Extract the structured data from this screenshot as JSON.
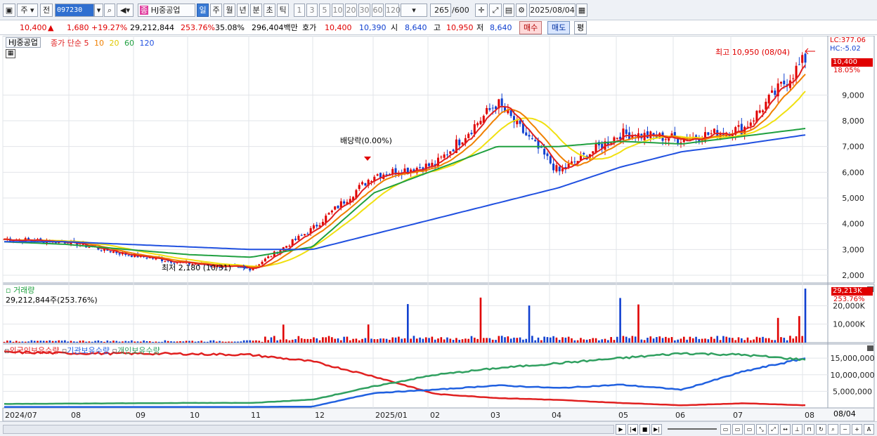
{
  "toolbar": {
    "type_select": "주",
    "prev_label": "전",
    "code_value": "097230",
    "stock_name": "HJ중공업",
    "periods": [
      "일",
      "주",
      "월",
      "년",
      "분",
      "초",
      "틱"
    ],
    "active_period": "일",
    "intervals": [
      "1",
      "3",
      "5",
      "10",
      "20",
      "30",
      "60",
      "120"
    ],
    "count_value": "265",
    "count_total": "/600",
    "date_value": "2025/08/04"
  },
  "quote": {
    "price": "10,400",
    "change": "1,680",
    "change_pct": "+19.27%",
    "volume": "29,212,844",
    "vol_ratio": "253.76%",
    "turnover": "35.08%",
    "amount": "296,404백만",
    "hoga_label": "호가",
    "ask": "10,400",
    "bid": "10,390",
    "open_label": "시",
    "open": "8,640",
    "high_label": "고",
    "high": "10,950",
    "low_label": "저",
    "low": "8,640",
    "buy_label": "매수",
    "sell_label": "매도",
    "eval_label": "평"
  },
  "price_pane": {
    "title": "HJ중공업",
    "ma_label": "종가 단순",
    "ma_periods": [
      "5",
      "10",
      "20",
      "60",
      "120"
    ],
    "lc_label": "LC:377.06",
    "hc_label": "HC:-5.02",
    "last_price_tag": "10,400",
    "last_pct_tag": "18.05%",
    "high_annotation": "최고 10,950 (08/04)",
    "low_annotation": "최저 2,180 (10/31)",
    "dividend_annotation": "배당락(0.00%)"
  },
  "volume_pane": {
    "title": "거래량",
    "summary": "29,212,844주(253.76%)",
    "last_tag": "29,213K",
    "last_pct": "253.76%"
  },
  "holdings_pane": {
    "legend": [
      "외국인보유수량",
      "기관보유수량",
      "개인보유수량"
    ]
  },
  "x_axis": {
    "labels": [
      "2024/07",
      "08",
      "09",
      "10",
      "11",
      "12",
      "2025/01",
      "02",
      "03",
      "04",
      "05",
      "06",
      "07",
      "08"
    ],
    "right_label": "08/04"
  },
  "colors": {
    "ma5": "#e02020",
    "ma10": "#f08000",
    "ma20": "#f0e010",
    "ma60": "#20a040",
    "ma120": "#2050e0",
    "up": "#e00000",
    "down": "#1040d0",
    "foreign": "#e02020",
    "institution": "#2060e0",
    "individual": "#30a060"
  },
  "chart_data": {
    "type": "candlestick",
    "x": [
      "2024/07",
      "08",
      "09",
      "10",
      "11",
      "12",
      "2025/01",
      "02",
      "03",
      "04",
      "05",
      "06",
      "07",
      "08"
    ],
    "price_ticks": [
      2000,
      3000,
      4000,
      5000,
      6000,
      7000,
      8000,
      9000
    ],
    "price_range": [
      1700,
      11300
    ],
    "close_approx": [
      3400,
      3300,
      2800,
      2450,
      2250,
      3800,
      5900,
      6300,
      8700,
      6000,
      7500,
      7300,
      7700,
      10400
    ],
    "ma60_approx": [
      3300,
      3200,
      3000,
      2800,
      2700,
      3100,
      5200,
      6100,
      7000,
      7000,
      7200,
      7100,
      7400,
      7700
    ],
    "ma120_approx": [
      3300,
      3300,
      3200,
      3100,
      3000,
      3000,
      3600,
      4200,
      4800,
      5400,
      6200,
      6800,
      7100,
      7450
    ],
    "volume_ticks_label": [
      "10,000K",
      "20,000K"
    ],
    "volume_range": [
      0,
      30000
    ],
    "holdings_ticks": [
      "5,000,000",
      "10,000,000",
      "15,000,000"
    ],
    "holdings_range": [
      0,
      18000000
    ],
    "holdings_series": [
      {
        "name": "외국인보유수량",
        "values": [
          16800000,
          16500000,
          16400000,
          16300000,
          16000000,
          14000000,
          9500000,
          4200000,
          3000000,
          2400000,
          1500000,
          800000,
          1400000,
          800000
        ]
      },
      {
        "name": "기관보유수량",
        "values": [
          300000,
          300000,
          300000,
          300000,
          300000,
          400000,
          4500000,
          5500000,
          6800000,
          6000000,
          7000000,
          5500000,
          11000000,
          15000000
        ]
      },
      {
        "name": "개인보유수량",
        "values": [
          1200000,
          1300000,
          1400000,
          1500000,
          1500000,
          2500000,
          6500000,
          10000000,
          12000000,
          13500000,
          15000000,
          16500000,
          16000000,
          14500000
        ]
      }
    ]
  }
}
